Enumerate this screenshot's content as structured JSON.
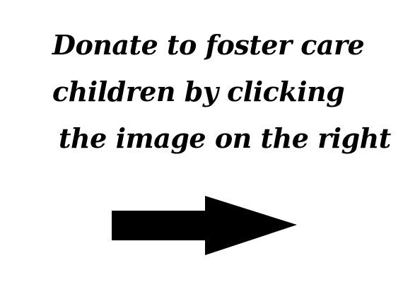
{
  "message": {
    "lines": [
      "Donate to foster care",
      "children by clicking",
      "the image on the right"
    ]
  },
  "arrow": {
    "icon": "arrow-right-icon",
    "color": "#000000"
  },
  "background_color": "#ffffff"
}
